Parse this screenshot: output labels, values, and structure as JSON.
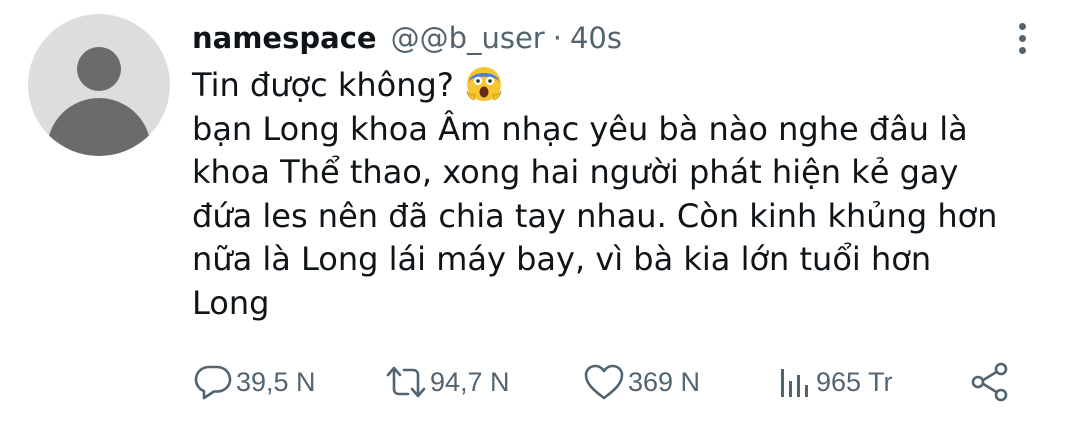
{
  "tweet": {
    "author": {
      "display_name": "namespace",
      "handle": "@@b_user",
      "separator": "·",
      "time": "40s"
    },
    "body_lines": [
      "Tin được không?",
      "bạn Long khoa Âm nhạc yêu bà nào nghe đâu là",
      "khoa Thể thao, xong hai người phát hiện kẻ gay",
      "đứa les nên đã chia tay nhau. Còn kinh khủng hơn",
      "nữa là Long lái máy bay, vì bà kia lớn tuổi hơn",
      "Long"
    ],
    "emoji": "screaming-face-emoji",
    "actions": {
      "reply_count": "39,5 N",
      "retweet_count": "94,7 N",
      "like_count": "369 N",
      "views_count": "965 Tr"
    },
    "icons": {
      "reply": "reply-icon",
      "retweet": "retweet-icon",
      "like": "heart-icon",
      "views": "views-icon",
      "share": "share-icon",
      "more": "more-options-icon"
    },
    "colors": {
      "text": "#0f1419",
      "secondary": "#536471",
      "avatar_bg": "#dddddd",
      "avatar_fg": "#6b6b6b"
    }
  }
}
